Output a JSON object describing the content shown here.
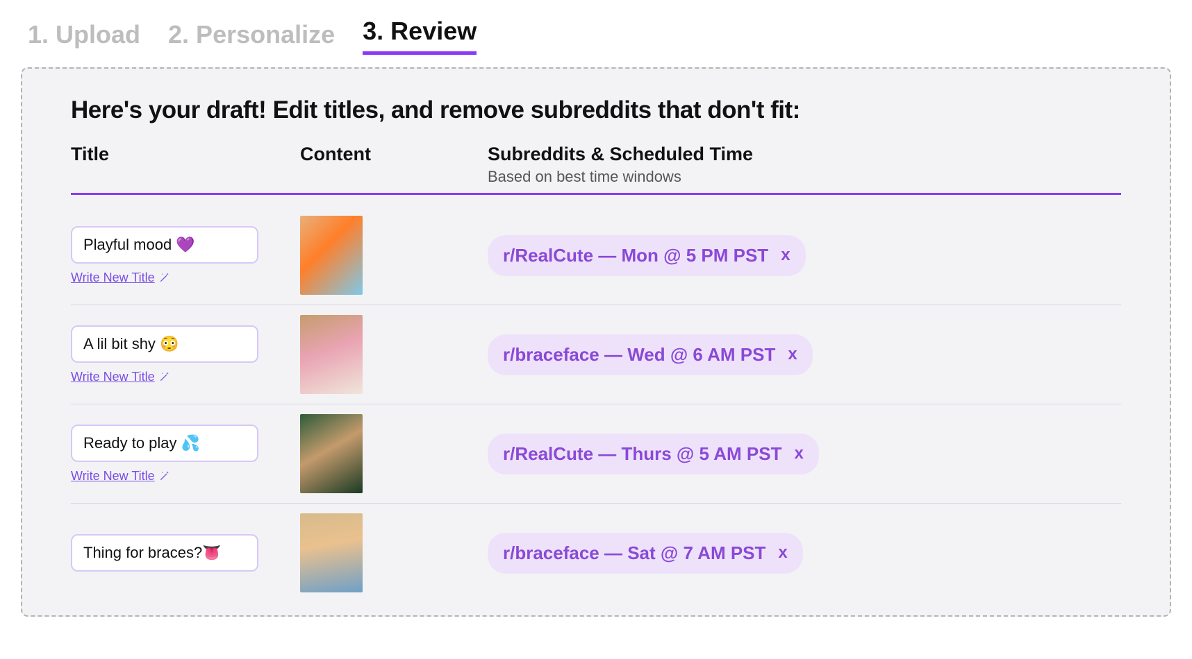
{
  "steps": {
    "step1": "1. Upload",
    "step2": "2. Personalize",
    "step3": "3. Review"
  },
  "headline": "Here's your draft! Edit titles, and remove subreddits that don't fit:",
  "columns": {
    "title": "Title",
    "content": "Content",
    "schedule_main": "Subreddits & Scheduled Time",
    "schedule_sub": "Based on best time windows"
  },
  "write_new_label": "Write New Title ",
  "remove_glyph": "x",
  "rows": [
    {
      "title": "Playful mood 💜",
      "thumb_class": "t1",
      "schedule": "r/RealCute — Mon @ 5 PM PST"
    },
    {
      "title": "A lil bit shy 😳",
      "thumb_class": "t2",
      "schedule": "r/braceface — Wed @ 6 AM PST"
    },
    {
      "title": "Ready to play 💦",
      "thumb_class": "t3",
      "schedule": "r/RealCute — Thurs @ 5 AM PST"
    },
    {
      "title": "Thing for braces?👅",
      "thumb_class": "t4",
      "schedule": "r/braceface — Sat @ 7 AM PST"
    }
  ]
}
